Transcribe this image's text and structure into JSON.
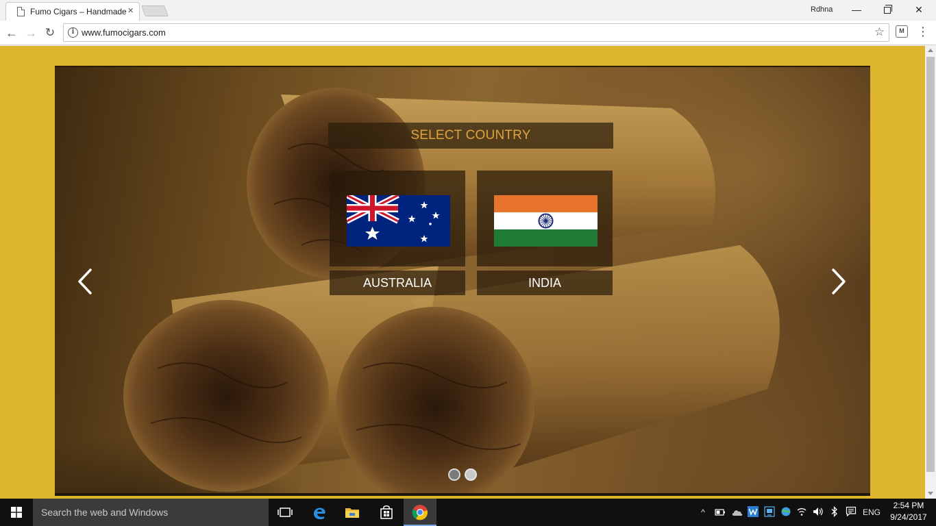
{
  "browser": {
    "tab_title": "Fumo Cigars – Handmade",
    "tab_close": "×",
    "profile_name": "Rdhna",
    "url": "www.fumocigars.com",
    "win_min": "—",
    "win_close": "✕"
  },
  "toolbar": {
    "back_icon": "←",
    "forward_icon": "→",
    "reload_icon": "↻",
    "info_icon": "i",
    "star_icon": "☆",
    "extension_icon": "M",
    "menu_icon": "⋮"
  },
  "page": {
    "select_title": "SELECT COUNTRY",
    "countries": [
      {
        "name": "AUSTRALIA"
      },
      {
        "name": "INDIA"
      }
    ],
    "slides": {
      "count": 2,
      "active": 1
    }
  },
  "taskbar": {
    "search_placeholder": "Search the web and Windows",
    "language": "ENG",
    "time": "2:54 PM",
    "date": "9/24/2017",
    "tray_chevron": "^"
  },
  "colors": {
    "page_background": "#deb62e",
    "select_title_text": "#e0a43a"
  }
}
